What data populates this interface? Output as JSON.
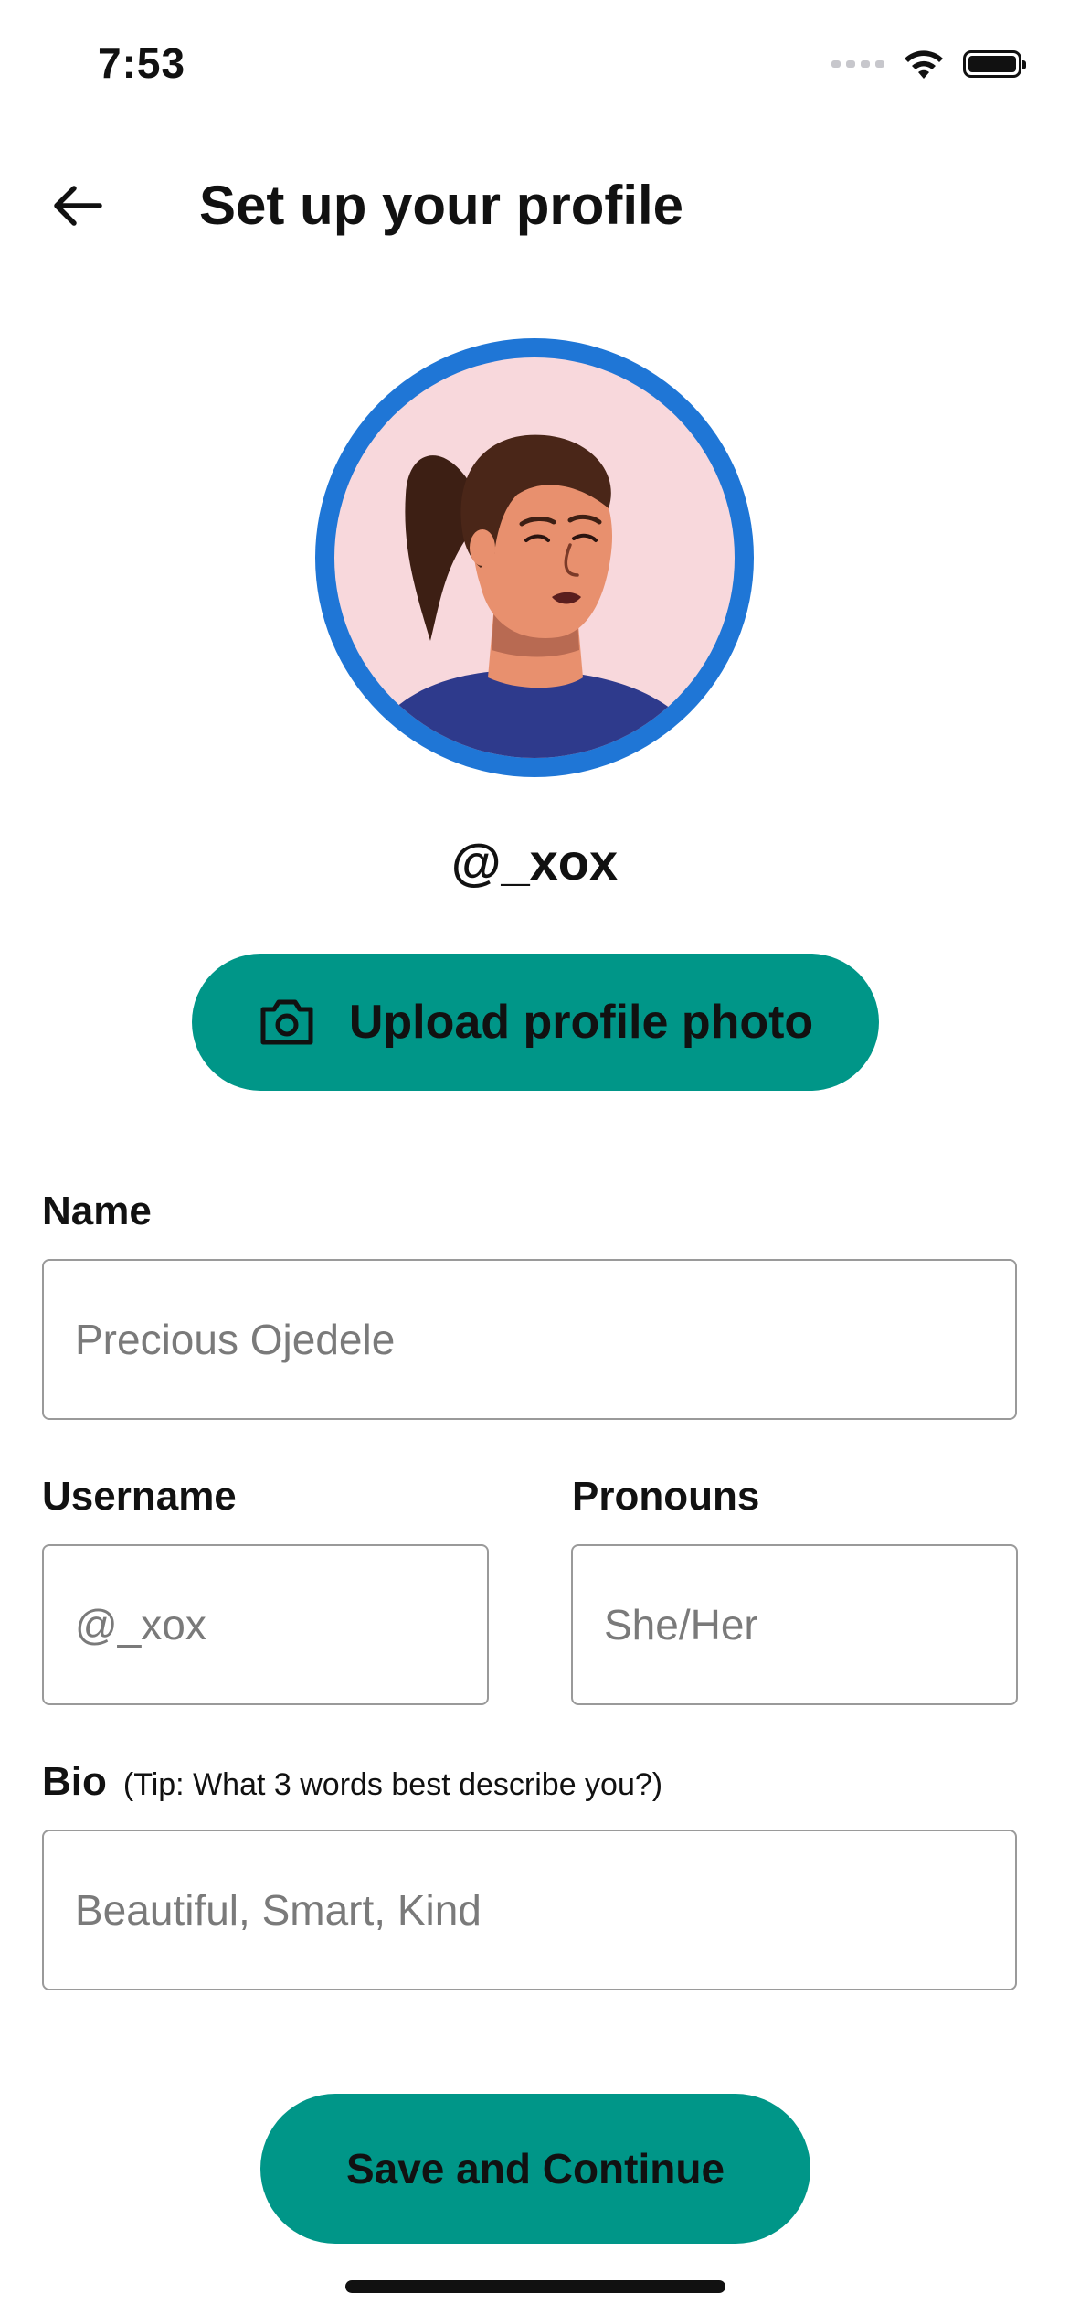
{
  "status_bar": {
    "time": "7:53"
  },
  "header": {
    "title": "Set up your profile"
  },
  "profile": {
    "handle": "@_xox",
    "upload_label": "Upload profile photo"
  },
  "form": {
    "name": {
      "label": "Name",
      "placeholder": "Precious Ojedele"
    },
    "username": {
      "label": "Username",
      "placeholder": "@_xox"
    },
    "pronouns": {
      "label": "Pronouns",
      "placeholder": "She/Her"
    },
    "bio": {
      "label": "Bio",
      "tip": "(Tip: What 3 words best describe you?)",
      "placeholder": "Beautiful, Smart, Kind"
    }
  },
  "actions": {
    "save_label": "Save and Continue"
  },
  "colors": {
    "accent": "#009688",
    "avatar_ring": "#1f76d6",
    "avatar_bg": "#f8d8dc"
  },
  "icons": {
    "back": "arrow-left-icon",
    "upload": "camera-icon",
    "wifi": "wifi-icon",
    "battery": "battery-icon",
    "signal": "signal-icon"
  }
}
